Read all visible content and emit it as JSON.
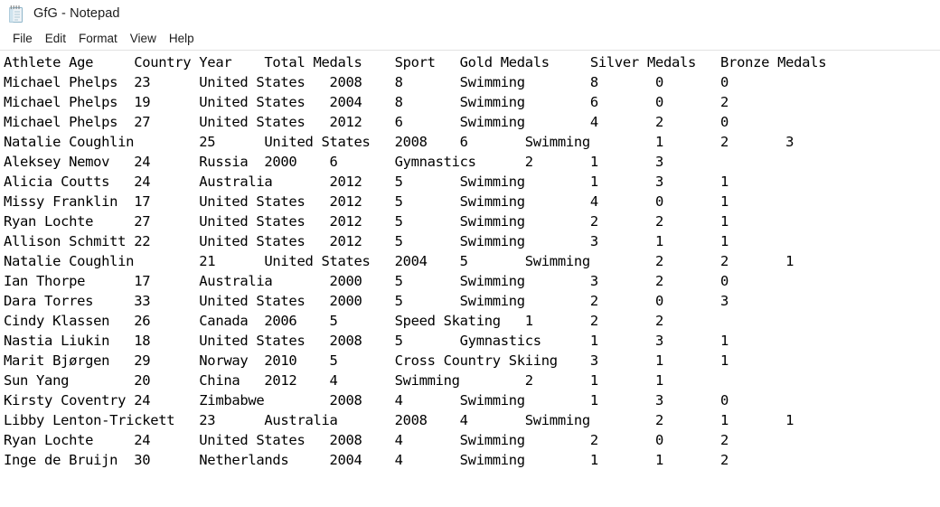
{
  "window": {
    "title": "GfG - Notepad",
    "icon": "notepad-icon"
  },
  "menubar": {
    "items": [
      {
        "label": "File"
      },
      {
        "label": "Edit"
      },
      {
        "label": "Format"
      },
      {
        "label": "View"
      },
      {
        "label": "Help"
      }
    ]
  },
  "document": {
    "columns": [
      "Athlete",
      "Age",
      "Country",
      "Year",
      "Total Medals",
      "Sport",
      "Gold Medals",
      "Silver Medals",
      "Bronze Medals"
    ],
    "rows": [
      [
        "Michael Phelps",
        "23",
        "United States",
        "2008",
        "8",
        "Swimming",
        "8",
        "0",
        "0"
      ],
      [
        "Michael Phelps",
        "19",
        "United States",
        "2004",
        "8",
        "Swimming",
        "6",
        "0",
        "2"
      ],
      [
        "Michael Phelps",
        "27",
        "United States",
        "2012",
        "6",
        "Swimming",
        "4",
        "2",
        "0"
      ],
      [
        "Natalie Coughlin",
        "25",
        "United States",
        "2008",
        "6",
        "Swimming",
        "1",
        "2",
        "3"
      ],
      [
        "Aleksey Nemov",
        "24",
        "Russia",
        "2000",
        "6",
        "Gymnastics",
        "2",
        "1",
        "3"
      ],
      [
        "Alicia Coutts",
        "24",
        "Australia",
        "2012",
        "5",
        "Swimming",
        "1",
        "3",
        "1"
      ],
      [
        "Missy Franklin",
        "17",
        "United States",
        "2012",
        "5",
        "Swimming",
        "4",
        "0",
        "1"
      ],
      [
        "Ryan Lochte",
        "27",
        "United States",
        "2012",
        "5",
        "Swimming",
        "2",
        "2",
        "1"
      ],
      [
        "Allison Schmitt",
        "22",
        "United States",
        "2012",
        "5",
        "Swimming",
        "3",
        "1",
        "1"
      ],
      [
        "Natalie Coughlin",
        "21",
        "United States",
        "2004",
        "5",
        "Swimming",
        "2",
        "2",
        "1"
      ],
      [
        "Ian Thorpe",
        "17",
        "Australia",
        "2000",
        "5",
        "Swimming",
        "3",
        "2",
        "0"
      ],
      [
        "Dara Torres",
        "33",
        "United States",
        "2000",
        "5",
        "Swimming",
        "2",
        "0",
        "3"
      ],
      [
        "Cindy Klassen",
        "26",
        "Canada",
        "2006",
        "5",
        "Speed Skating",
        "1",
        "2",
        "2"
      ],
      [
        "Nastia Liukin",
        "18",
        "United States",
        "2008",
        "5",
        "Gymnastics",
        "1",
        "3",
        "1"
      ],
      [
        "Marit Bjørgen",
        "29",
        "Norway",
        "2010",
        "5",
        "Cross Country Skiing",
        "3",
        "1",
        "1"
      ],
      [
        "Sun Yang",
        "20",
        "China",
        "2012",
        "4",
        "Swimming",
        "2",
        "1",
        "1"
      ],
      [
        "Kirsty Coventry",
        "24",
        "Zimbabwe",
        "2008",
        "4",
        "Swimming",
        "1",
        "3",
        "0"
      ],
      [
        "Libby Lenton-Trickett",
        "23",
        "Australia",
        "2008",
        "4",
        "Swimming",
        "2",
        "1",
        "1"
      ],
      [
        "Ryan Lochte",
        "24",
        "United States",
        "2008",
        "4",
        "Swimming",
        "2",
        "0",
        "2"
      ],
      [
        "Inge de Bruijn",
        "30",
        "Netherlands",
        "2004",
        "4",
        "Swimming",
        "1",
        "1",
        "2"
      ]
    ]
  },
  "colors": {
    "background": "#ffffff",
    "text": "#000000",
    "title_text": "#1d1d1d",
    "menu_separator": "#e2e2e2",
    "icon_body": "#eef3f7",
    "icon_accent": "#7fb8d4"
  }
}
